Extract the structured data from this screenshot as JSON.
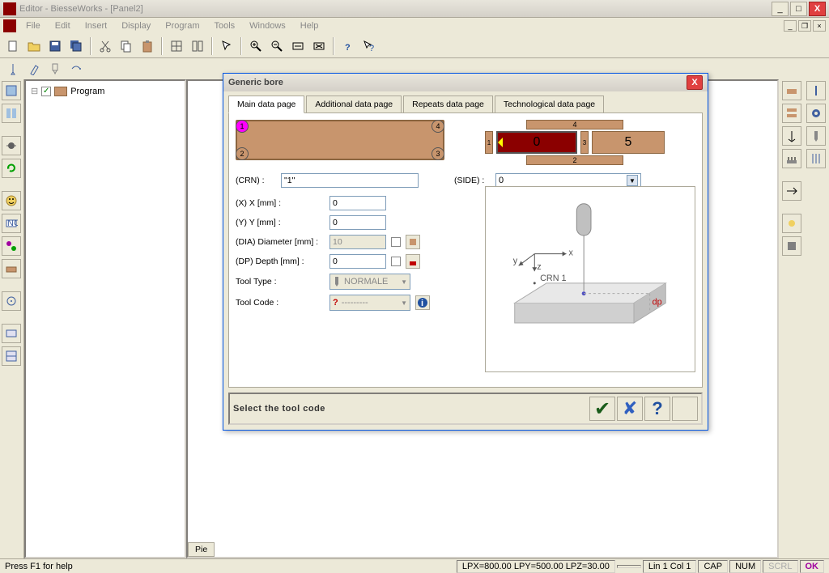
{
  "titlebar": {
    "title": "Editor - BiesseWorks - [Panel2]"
  },
  "menu": {
    "file": "File",
    "edit": "Edit",
    "insert": "Insert",
    "display": "Display",
    "program": "Program",
    "tools": "Tools",
    "windows": "Windows",
    "help": "Help"
  },
  "tree": {
    "program": "Program"
  },
  "dialog": {
    "title": "Generic bore",
    "tabs": {
      "main": "Main data page",
      "additional": "Additional data page",
      "repeats": "Repeats data page",
      "tech": "Technological data page"
    },
    "crn_label": "(CRN) :",
    "crn_value": "\"1\"",
    "side_label": "(SIDE) :",
    "side_value": "0",
    "corners": {
      "c1": "1",
      "c2": "2",
      "c3": "3",
      "c4": "4"
    },
    "side_top": "4",
    "side_bottom": "2",
    "side_l": "1",
    "side_r": "3",
    "side_center": "0",
    "side_five": "5",
    "fields": {
      "x_label": "(X) X [mm] :",
      "x_val": "0",
      "y_label": "(Y) Y [mm] :",
      "y_val": "0",
      "dia_label": "(DIA) Diameter [mm] :",
      "dia_val": "10",
      "dp_label": "(DP) Depth [mm] :",
      "dp_val": "0",
      "tooltype_label": "Tool Type :",
      "tooltype_val": "NORMALE",
      "toolcode_label": "Tool Code :"
    },
    "preview_label": "CRN 1",
    "preview_dp": "dp",
    "instruction": "Select the tool code"
  },
  "statusbar": {
    "help": "Press F1 for help",
    "lpx": "LPX=800.00  LPY=500.00  LPZ=30.00",
    "lincol": "Lin 1  Col 1",
    "cap": "CAP",
    "num": "NUM",
    "scrl": "SCRL",
    "ok": "OK"
  },
  "center_tab": "Pie"
}
